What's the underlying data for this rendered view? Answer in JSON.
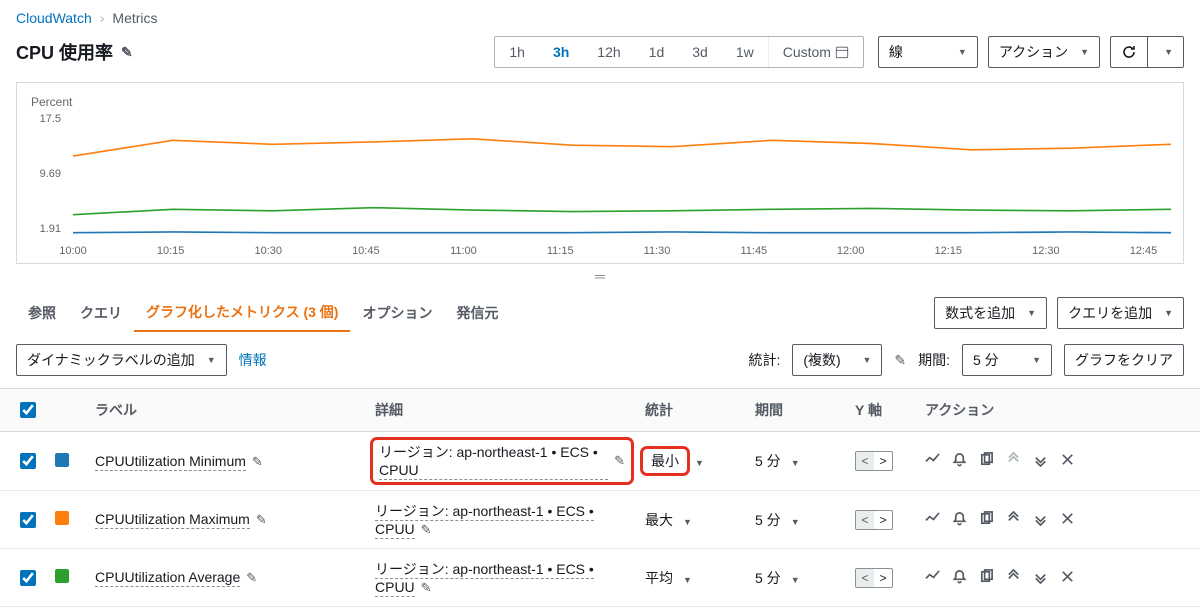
{
  "breadcrumb": {
    "root": "CloudWatch",
    "current": "Metrics"
  },
  "title": "CPU 使用率",
  "range": {
    "options": [
      "1h",
      "3h",
      "12h",
      "1d",
      "3d",
      "1w"
    ],
    "active": "3h",
    "custom_label": "Custom"
  },
  "toolbar": {
    "chart_type": "線",
    "actions": "アクション"
  },
  "chart": {
    "ylabel": "Percent",
    "yticks": [
      "17.5",
      "9.69",
      "1.91"
    ],
    "xticks": [
      "10:00",
      "10:15",
      "10:30",
      "10:45",
      "11:00",
      "11:15",
      "11:30",
      "11:45",
      "12:00",
      "12:15",
      "12:30",
      "12:45"
    ]
  },
  "chart_data": {
    "type": "line",
    "xlabel": "",
    "ylabel": "Percent",
    "ylim": [
      1.91,
      17.5
    ],
    "x": [
      "10:00",
      "10:15",
      "10:30",
      "10:45",
      "11:00",
      "11:15",
      "11:30",
      "11:45",
      "12:00",
      "12:15",
      "12:30",
      "12:45"
    ],
    "series": [
      {
        "name": "CPUUtilization Minimum",
        "color": "#1f77b4",
        "values": [
          2.2,
          2.3,
          2.2,
          2.2,
          2.2,
          2.2,
          2.3,
          2.2,
          2.2,
          2.2,
          2.3,
          2.2
        ]
      },
      {
        "name": "CPUUtilization Maximum",
        "color": "#ff7f0e",
        "values": [
          12.0,
          14.0,
          13.5,
          13.8,
          14.2,
          13.4,
          13.2,
          14.0,
          13.6,
          12.8,
          13.0,
          13.5
        ]
      },
      {
        "name": "CPUUtilization Average",
        "color": "#2ca02c",
        "values": [
          4.5,
          5.2,
          5.0,
          5.4,
          5.1,
          4.9,
          5.0,
          5.2,
          5.3,
          5.1,
          5.0,
          5.2
        ]
      }
    ]
  },
  "tabs": {
    "items": [
      "参照",
      "クエリ",
      "グラフ化したメトリクス (3 個)",
      "オプション",
      "発信元"
    ],
    "active_index": 2,
    "add_math": "数式を追加",
    "add_query": "クエリを追加"
  },
  "filter": {
    "dyn_label": "ダイナミックラベルの追加",
    "info": "情報",
    "stat_label": "統計:",
    "stat_value": "(複数)",
    "period_label": "期間:",
    "period_value": "5 分",
    "clear_graph": "グラフをクリア"
  },
  "table": {
    "headers": {
      "label": "ラベル",
      "detail": "詳細",
      "stat": "統計",
      "period": "期間",
      "yaxis": "Y 軸",
      "actions": "アクション"
    },
    "rows": [
      {
        "color": "#1f77b4",
        "label": "CPUUtilization Minimum",
        "detail": "リージョン: ap-northeast-1 • ECS • CPUU",
        "stat": "最小",
        "period": "5 分",
        "highlight": true,
        "up_disabled": true
      },
      {
        "color": "#ff7f0e",
        "label": "CPUUtilization Maximum",
        "detail": "リージョン: ap-northeast-1 • ECS • CPUU",
        "stat": "最大",
        "period": "5 分",
        "highlight": false,
        "up_disabled": false
      },
      {
        "color": "#2ca02c",
        "label": "CPUUtilization Average",
        "detail": "リージョン: ap-northeast-1 • ECS • CPUU",
        "stat": "平均",
        "period": "5 分",
        "highlight": false,
        "up_disabled": false
      }
    ]
  }
}
